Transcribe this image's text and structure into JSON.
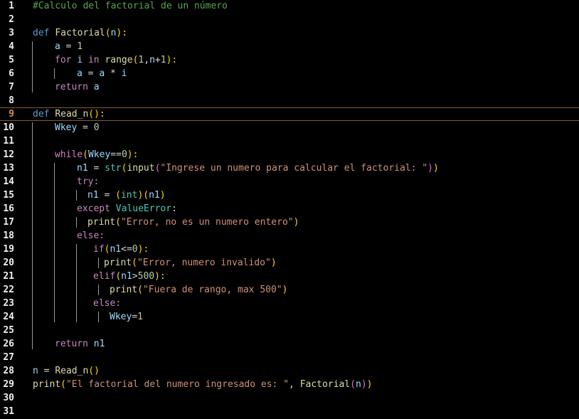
{
  "colors": {
    "background": "#000000",
    "comment": "#57a64a",
    "keyword": "#569cd6",
    "control": "#c586c0",
    "function": "#dcdcaa",
    "identifier": "#9cdcfe",
    "number": "#b5cea8",
    "string": "#ce9178",
    "type": "#4ec9b0",
    "current_line_border": "#8a5a2b"
  },
  "editor": {
    "current_line": 9,
    "lines": [
      {
        "n": "1",
        "indent": 0,
        "tokens": [
          {
            "t": "#Calculo del factorial de un número",
            "c": "c-comment"
          }
        ]
      },
      {
        "n": "2",
        "indent": 0,
        "tokens": []
      },
      {
        "n": "3",
        "indent": 0,
        "tokens": [
          {
            "t": "def ",
            "c": "c-kw"
          },
          {
            "t": "Factorial",
            "c": "c-fn"
          },
          {
            "t": "(",
            "c": "c-br1"
          },
          {
            "t": "n",
            "c": "c-id"
          },
          {
            "t": "):",
            "c": "c-br1"
          }
        ]
      },
      {
        "n": "4",
        "indent": 1,
        "tokens": [
          {
            "t": "a",
            "c": "c-id"
          },
          {
            "t": " = ",
            "c": "c-op"
          },
          {
            "t": "1",
            "c": "c-num"
          }
        ]
      },
      {
        "n": "5",
        "indent": 1,
        "tokens": [
          {
            "t": "for ",
            "c": "c-ctrl"
          },
          {
            "t": "i",
            "c": "c-id"
          },
          {
            "t": " in ",
            "c": "c-ctrl"
          },
          {
            "t": "range",
            "c": "c-fn"
          },
          {
            "t": "(",
            "c": "c-br1"
          },
          {
            "t": "1",
            "c": "c-num"
          },
          {
            "t": ",",
            "c": "c-op"
          },
          {
            "t": "n",
            "c": "c-id"
          },
          {
            "t": "+",
            "c": "c-op"
          },
          {
            "t": "1",
            "c": "c-num"
          },
          {
            "t": "):",
            "c": "c-br1"
          }
        ]
      },
      {
        "n": "6",
        "indent": 2,
        "tokens": [
          {
            "t": "a",
            "c": "c-id"
          },
          {
            "t": " = ",
            "c": "c-op"
          },
          {
            "t": "a",
            "c": "c-id"
          },
          {
            "t": " * ",
            "c": "c-op"
          },
          {
            "t": "i",
            "c": "c-id"
          }
        ]
      },
      {
        "n": "7",
        "indent": 1,
        "tokens": [
          {
            "t": "return ",
            "c": "c-ctrl"
          },
          {
            "t": "a",
            "c": "c-id"
          }
        ]
      },
      {
        "n": "8",
        "indent": 0,
        "tokens": []
      },
      {
        "n": "9",
        "indent": 0,
        "tokens": [
          {
            "t": "def ",
            "c": "c-kw"
          },
          {
            "t": "Read_n",
            "c": "c-fn"
          },
          {
            "t": "():",
            "c": "c-br1"
          }
        ]
      },
      {
        "n": "10",
        "indent": 1,
        "tokens": [
          {
            "t": "Wkey",
            "c": "c-id"
          },
          {
            "t": " = ",
            "c": "c-op"
          },
          {
            "t": "0",
            "c": "c-num"
          }
        ]
      },
      {
        "n": "11",
        "indent": 0,
        "tokens": []
      },
      {
        "n": "12",
        "indent": 1,
        "tokens": [
          {
            "t": "while",
            "c": "c-ctrl"
          },
          {
            "t": "(",
            "c": "c-br1"
          },
          {
            "t": "Wkey",
            "c": "c-id"
          },
          {
            "t": "==",
            "c": "c-op"
          },
          {
            "t": "0",
            "c": "c-num"
          },
          {
            "t": "):",
            "c": "c-br1"
          }
        ]
      },
      {
        "n": "13",
        "indent": 2,
        "tokens": [
          {
            "t": "n1",
            "c": "c-id"
          },
          {
            "t": " = ",
            "c": "c-op"
          },
          {
            "t": "str",
            "c": "c-type"
          },
          {
            "t": "(",
            "c": "c-br1"
          },
          {
            "t": "input",
            "c": "c-fn"
          },
          {
            "t": "(",
            "c": "c-br2"
          },
          {
            "t": "\"Ingrese un numero para calcular el factorial: \"",
            "c": "c-str"
          },
          {
            "t": ")",
            "c": "c-br2"
          },
          {
            "t": ")",
            "c": "c-br1"
          }
        ]
      },
      {
        "n": "14",
        "indent": 2,
        "tokens": [
          {
            "t": "try:",
            "c": "c-ctrl"
          }
        ]
      },
      {
        "n": "15",
        "indent": 3,
        "tokens": [
          {
            "t": "n1",
            "c": "c-id"
          },
          {
            "t": " = ",
            "c": "c-op"
          },
          {
            "t": "(",
            "c": "c-br1"
          },
          {
            "t": "int",
            "c": "c-type"
          },
          {
            "t": ")",
            "c": "c-br1"
          },
          {
            "t": "(",
            "c": "c-br1"
          },
          {
            "t": "n1",
            "c": "c-id"
          },
          {
            "t": ")",
            "c": "c-br1"
          }
        ]
      },
      {
        "n": "16",
        "indent": 2,
        "tokens": [
          {
            "t": "except ",
            "c": "c-ctrl"
          },
          {
            "t": "ValueError",
            "c": "c-type"
          },
          {
            "t": ":",
            "c": "c-op"
          }
        ]
      },
      {
        "n": "17",
        "indent": 3,
        "tokens": [
          {
            "t": "print",
            "c": "c-fn"
          },
          {
            "t": "(",
            "c": "c-br1"
          },
          {
            "t": "\"Error, no es un numero entero\"",
            "c": "c-str"
          },
          {
            "t": ")",
            "c": "c-br1"
          }
        ]
      },
      {
        "n": "18",
        "indent": 2,
        "tokens": [
          {
            "t": "else:",
            "c": "c-ctrl"
          }
        ]
      },
      {
        "n": "19",
        "indent": 4,
        "tokens": [
          {
            "t": "if",
            "c": "c-ctrl"
          },
          {
            "t": "(",
            "c": "c-br1"
          },
          {
            "t": "n1",
            "c": "c-id"
          },
          {
            "t": "<=",
            "c": "c-op"
          },
          {
            "t": "0",
            "c": "c-num"
          },
          {
            "t": "):",
            "c": "c-br1"
          }
        ]
      },
      {
        "n": "20",
        "indent": 5,
        "tokens": [
          {
            "t": "print",
            "c": "c-fn"
          },
          {
            "t": "(",
            "c": "c-br1"
          },
          {
            "t": "\"Error, numero invalido\"",
            "c": "c-str"
          },
          {
            "t": ")",
            "c": "c-br1"
          }
        ]
      },
      {
        "n": "21",
        "indent": 4,
        "tokens": [
          {
            "t": "elif",
            "c": "c-ctrl"
          },
          {
            "t": "(",
            "c": "c-br1"
          },
          {
            "t": "n1",
            "c": "c-id"
          },
          {
            "t": ">",
            "c": "c-op"
          },
          {
            "t": "500",
            "c": "c-num"
          },
          {
            "t": "):",
            "c": "c-br1"
          }
        ]
      },
      {
        "n": "22",
        "indent": 6,
        "tokens": [
          {
            "t": "print",
            "c": "c-fn"
          },
          {
            "t": "(",
            "c": "c-br1"
          },
          {
            "t": "\"Fuera de rango, max 500\"",
            "c": "c-str"
          },
          {
            "t": ")",
            "c": "c-br1"
          }
        ]
      },
      {
        "n": "23",
        "indent": 4,
        "tokens": [
          {
            "t": "else:",
            "c": "c-ctrl"
          }
        ]
      },
      {
        "n": "24",
        "indent": 6,
        "tokens": [
          {
            "t": "Wkey",
            "c": "c-id"
          },
          {
            "t": "=",
            "c": "c-op"
          },
          {
            "t": "1",
            "c": "c-num"
          }
        ]
      },
      {
        "n": "25",
        "indent": 0,
        "tokens": []
      },
      {
        "n": "26",
        "indent": 1,
        "tokens": [
          {
            "t": "return ",
            "c": "c-ctrl"
          },
          {
            "t": "n1",
            "c": "c-id"
          }
        ]
      },
      {
        "n": "27",
        "indent": 0,
        "tokens": []
      },
      {
        "n": "28",
        "indent": 0,
        "tokens": [
          {
            "t": "n",
            "c": "c-id"
          },
          {
            "t": " = ",
            "c": "c-op"
          },
          {
            "t": "Read_n",
            "c": "c-fn"
          },
          {
            "t": "()",
            "c": "c-br1"
          }
        ]
      },
      {
        "n": "29",
        "indent": 0,
        "tokens": [
          {
            "t": "print",
            "c": "c-fn"
          },
          {
            "t": "(",
            "c": "c-br1"
          },
          {
            "t": "\"El factorial del numero ingresado es: \"",
            "c": "c-str"
          },
          {
            "t": ", ",
            "c": "c-op"
          },
          {
            "t": "Factorial",
            "c": "c-fn"
          },
          {
            "t": "(",
            "c": "c-br2"
          },
          {
            "t": "n",
            "c": "c-id"
          },
          {
            "t": ")",
            "c": "c-br2"
          },
          {
            "t": ")",
            "c": "c-br1"
          }
        ]
      },
      {
        "n": "30",
        "indent": 0,
        "tokens": []
      },
      {
        "n": "31",
        "indent": 0,
        "tokens": []
      }
    ]
  }
}
